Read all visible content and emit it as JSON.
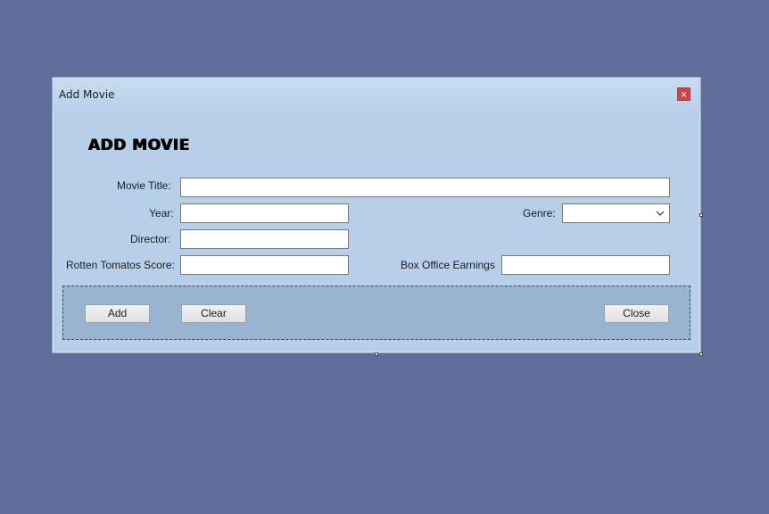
{
  "window": {
    "title": "Add Movie",
    "close_glyph": "×"
  },
  "form": {
    "heading": "ADD MOVIE",
    "movie_title_label": "Movie Title:",
    "movie_title_value": "",
    "year_label": "Year:",
    "year_value": "",
    "genre_label": "Genre:",
    "genre_value": "",
    "director_label": "Director:",
    "director_value": "",
    "rotten_label": "Rotten Tomatos Score:",
    "rotten_value": "",
    "box_office_label": "Box Office Earnings",
    "box_office_value": ""
  },
  "buttons": {
    "add": "Add",
    "clear": "Clear",
    "close": "Close"
  },
  "colors": {
    "desktop": "#5f6d9b",
    "window": "#b7cfe9",
    "button_panel": "#99b4d1",
    "close_button": "#c7464c"
  }
}
